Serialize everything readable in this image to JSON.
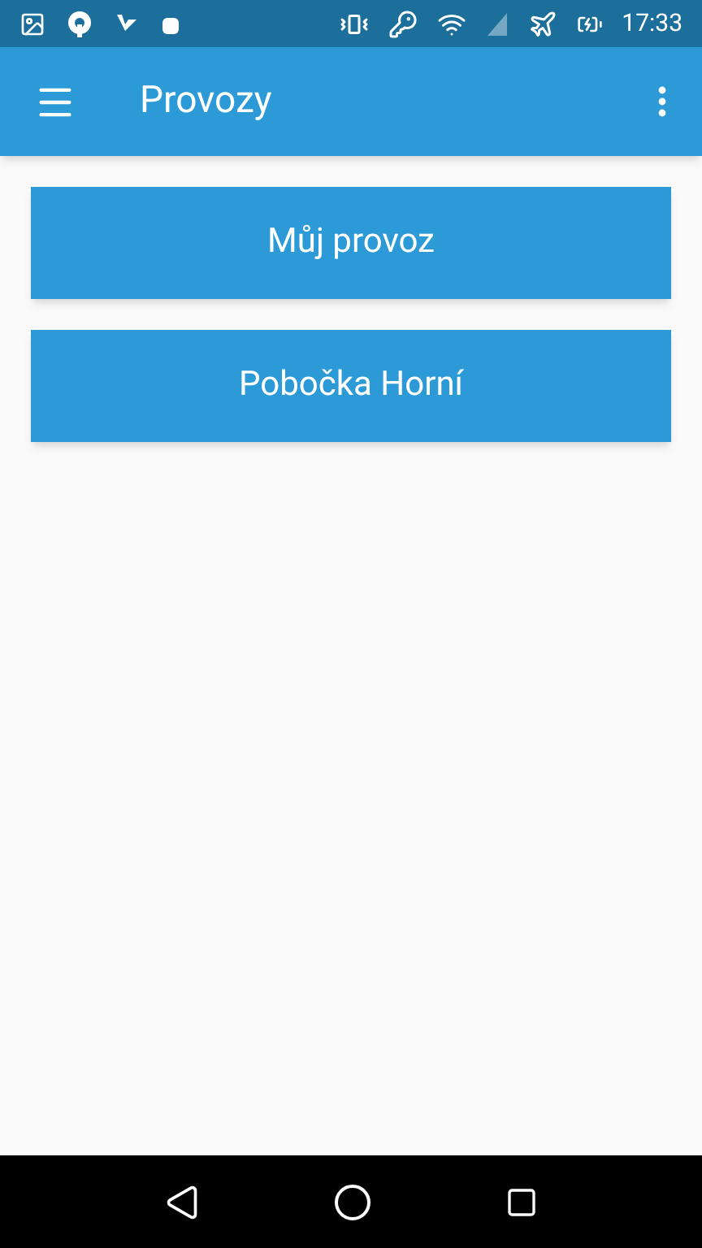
{
  "status_bar": {
    "time": "17:33"
  },
  "app_bar": {
    "title": "Provozy"
  },
  "items": [
    {
      "label": "Můj provoz"
    },
    {
      "label": "Pobočka Horní"
    }
  ]
}
